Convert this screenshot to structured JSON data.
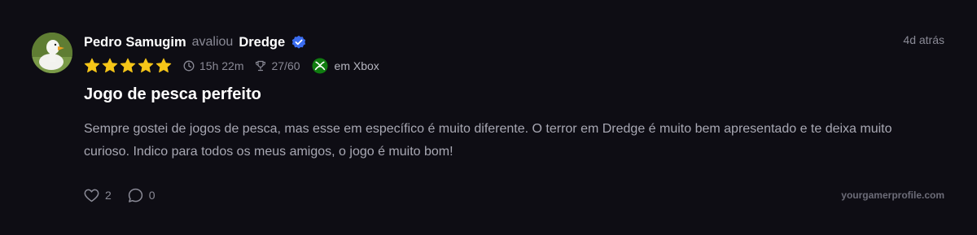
{
  "review": {
    "user_name": "Pedro Samugim",
    "action_verb": "avaliou",
    "game_title": "Dredge",
    "timestamp": "4d atrás",
    "rating": 5,
    "playtime": "15h 22m",
    "achievements": "27/60",
    "platform": "em Xbox",
    "title": "Jogo de pesca perfeito",
    "body": "Sempre gostei de jogos de pesca, mas esse em específico é muito diferente. O terror em Dredge é muito bem apresentado e te deixa muito curioso. Indico para todos os meus amigos, o jogo é muito bom!",
    "likes": "2",
    "comments": "0"
  },
  "footer": {
    "site": "yourgamerprofile.com"
  },
  "icons": {
    "avatar": "duck-avatar",
    "verified": "verified-badge-icon",
    "star": "star-icon",
    "clock": "clock-icon",
    "trophy": "trophy-icon",
    "platform": "xbox-icon",
    "like": "heart-icon",
    "comment": "comment-icon"
  },
  "colors": {
    "background": "#0e0d14",
    "star": "#f5c518",
    "verified": "#3b6df0",
    "xbox": "#107c10",
    "muted": "#8a8a96"
  }
}
